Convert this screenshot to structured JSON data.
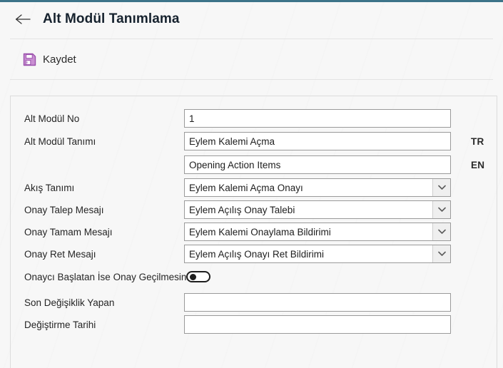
{
  "theme": {
    "accent_bar_color": "#3d7489",
    "title_color": "#16222e",
    "save_icon_color": "#a45fb0",
    "background_color": "#f7f7f7",
    "input_border_color": "#9a9a9a"
  },
  "header": {
    "back_icon": "arrow-left-icon",
    "title": "Alt Modül Tanımlama"
  },
  "commandbar": {
    "save": {
      "icon": "floppy-save-icon",
      "label": "Kaydet"
    }
  },
  "form": {
    "rows": [
      {
        "label": "Alt Modül No",
        "type": "text",
        "value": "1",
        "name": "alt-modul-no"
      },
      {
        "label": "Alt Modül Tanımı",
        "type": "text",
        "value": "Eylem Kalemi Açma",
        "lang": "TR",
        "name": "alt-modul-tanimi-tr"
      },
      {
        "label": "",
        "type": "text",
        "value": "Opening Action Items",
        "lang": "EN",
        "name": "alt-modul-tanimi-en"
      },
      {
        "label": "Akış Tanımı",
        "type": "select",
        "value": "Eylem Kalemi Açma Onayı",
        "name": "akis-tanimi"
      },
      {
        "label": "Onay Talep Mesajı",
        "type": "select",
        "value": "Eylem Açılış Onay Talebi",
        "name": "onay-talep-mesaji"
      },
      {
        "label": "Onay Tamam Mesajı",
        "type": "select",
        "value": "Eylem Kalemi Onaylama Bildirimi",
        "name": "onay-tamam-mesaji"
      },
      {
        "label": "Onay Ret Mesajı",
        "type": "select",
        "value": "Eylem Açılış Onayı Ret Bildirimi",
        "name": "onay-ret-mesaji"
      },
      {
        "label": "Onaycı Başlatan İse Onay Geçilmesin",
        "type": "toggle",
        "value": "off",
        "name": "onayci-baslatan-ise-onay-gecilmesin"
      },
      {
        "label": "Son Değişiklik Yapan",
        "type": "text",
        "value": "",
        "name": "son-degisiklik-yapan"
      },
      {
        "label": "Değiştirme Tarihi",
        "type": "text",
        "value": "",
        "name": "degistirme-tarihi"
      }
    ]
  }
}
